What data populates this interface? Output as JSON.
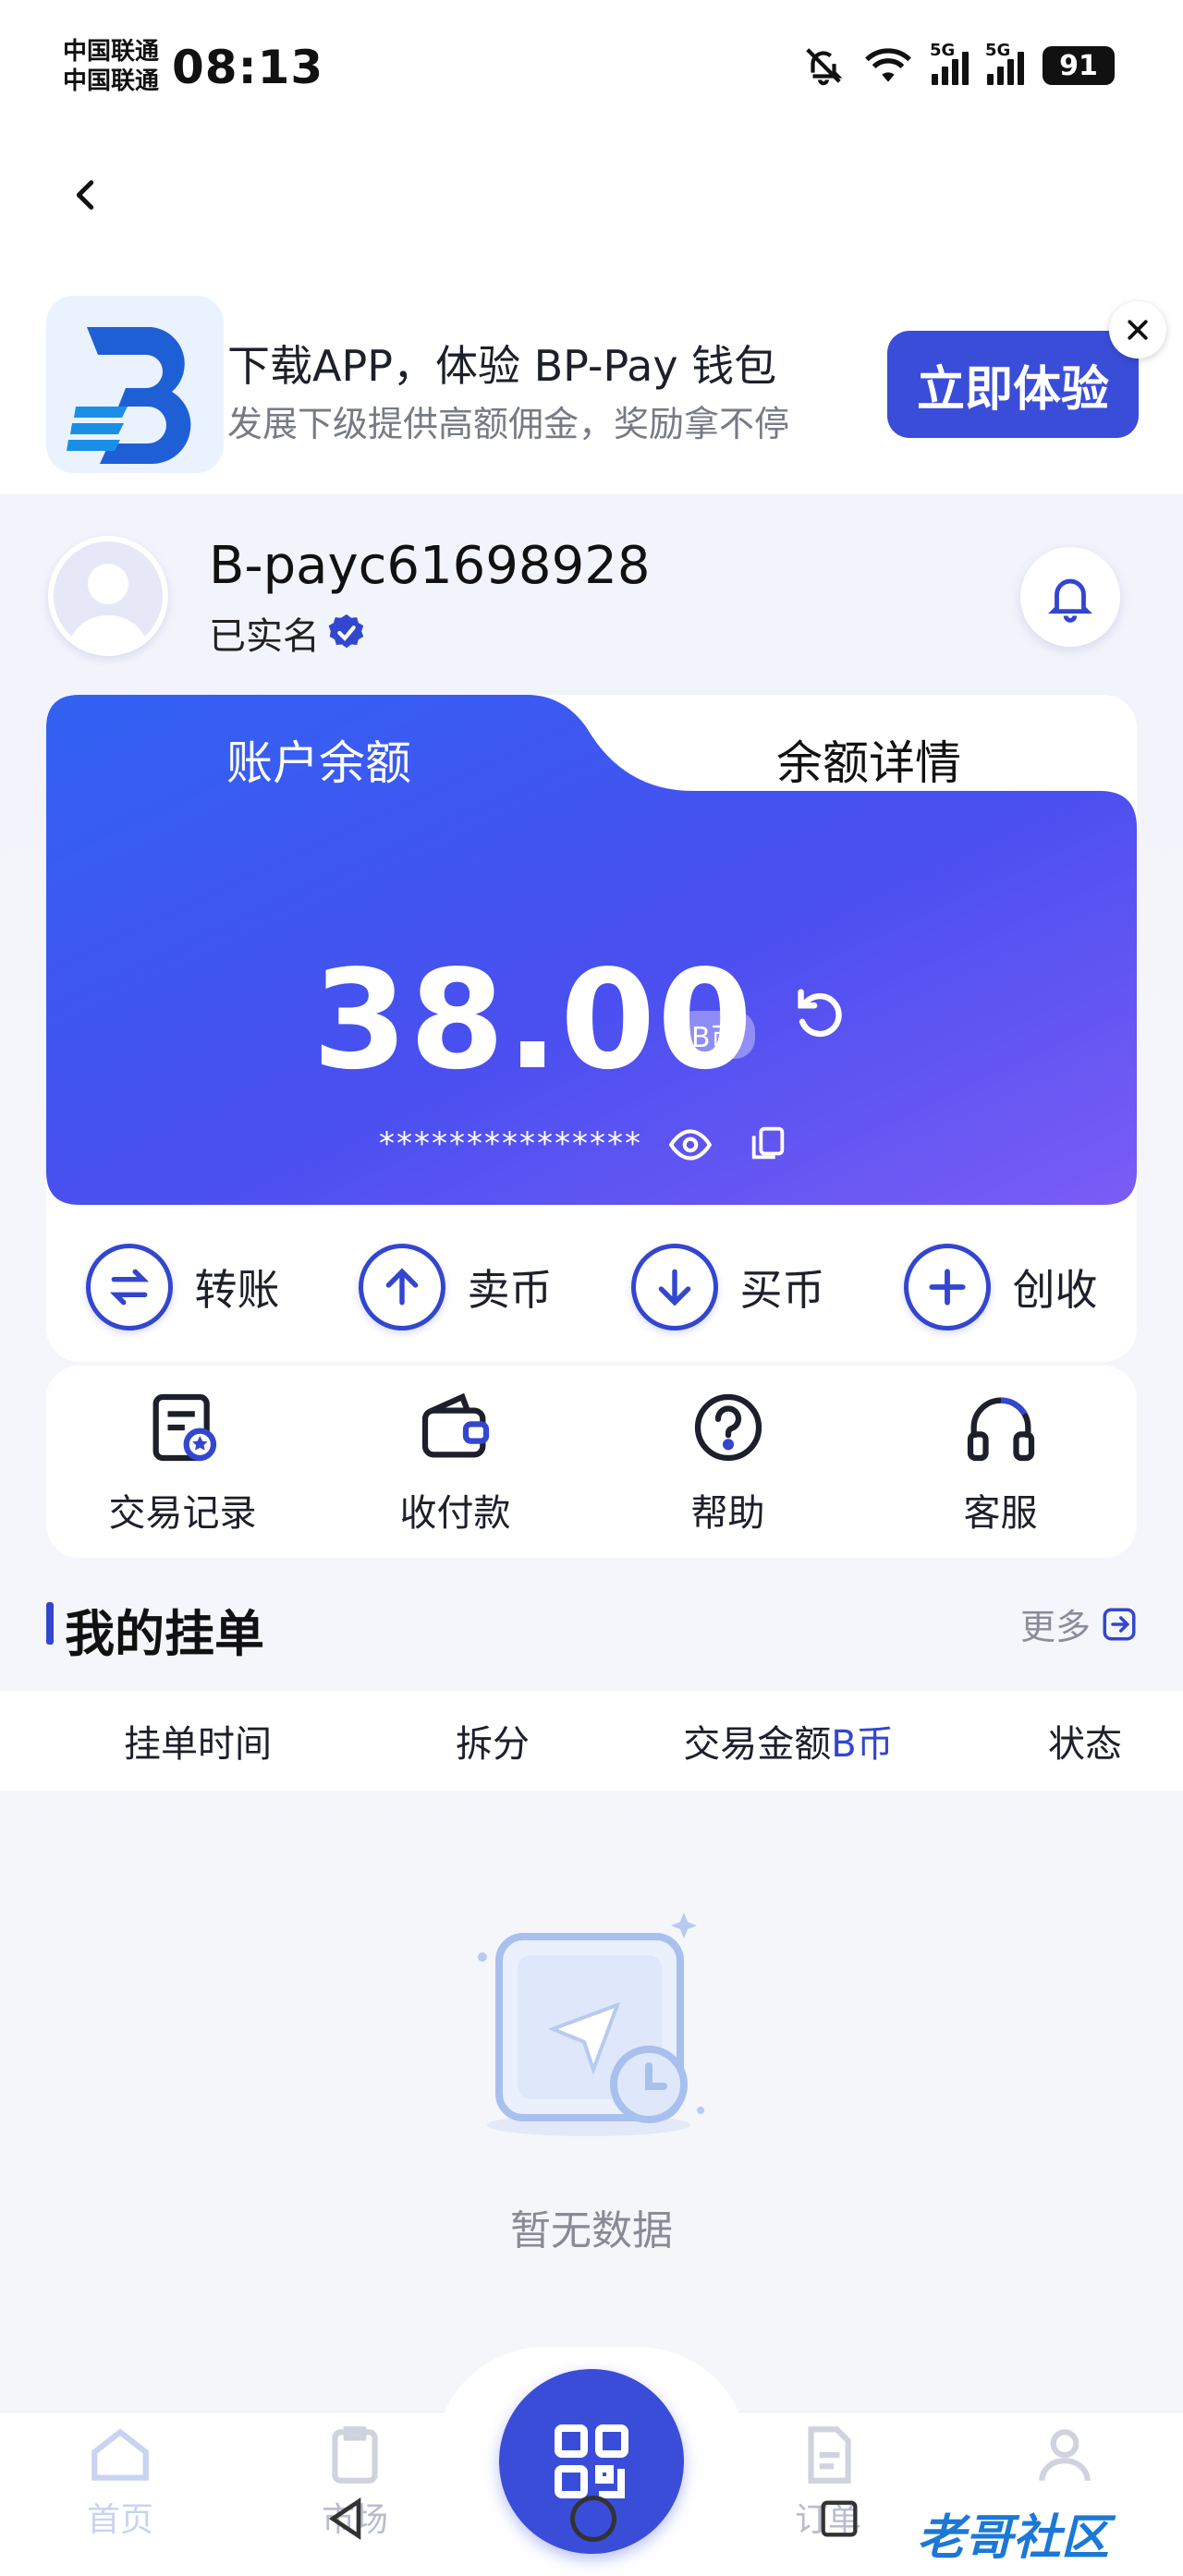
{
  "status_bar": {
    "carrier_1": "中国联通",
    "carrier_2": "中国联通",
    "time": "08:13",
    "network_1": "5G",
    "network_2": "5G",
    "battery": "91"
  },
  "banner": {
    "title": "下载APP，体验 BP-Pay 钱包",
    "subtitle": "发展下级提供高额佣金，奖励拿不停",
    "cta_label": "立即体验"
  },
  "user": {
    "username": "B-payc61698928",
    "verified_label": "已实名"
  },
  "balance_card": {
    "tab_active": "账户余额",
    "tab_inactive": "余额详情",
    "amount": "38.00",
    "unit": "B币",
    "masked_text": "***************",
    "accent_color": "#3a4dd9"
  },
  "actions": [
    {
      "label": "转账",
      "icon": "transfer-icon"
    },
    {
      "label": "卖币",
      "icon": "arrow-up-icon"
    },
    {
      "label": "买币",
      "icon": "arrow-down-icon"
    },
    {
      "label": "创收",
      "icon": "plus-icon"
    }
  ],
  "shortcuts": [
    {
      "label": "交易记录",
      "icon": "records-icon"
    },
    {
      "label": "收付款",
      "icon": "wallet-icon"
    },
    {
      "label": "帮助",
      "icon": "help-icon"
    },
    {
      "label": "客服",
      "icon": "headset-icon"
    }
  ],
  "orders": {
    "title": "我的挂单",
    "more_label": "更多",
    "columns": [
      "挂单时间",
      "拆分",
      "交易金额",
      "状态"
    ],
    "amount_unit": "B币",
    "empty_text": "暂无数据"
  },
  "bottom_nav": {
    "home_label": "首页",
    "item2_label": "市场",
    "item4_label": "订单"
  },
  "watermark": "老哥社区"
}
